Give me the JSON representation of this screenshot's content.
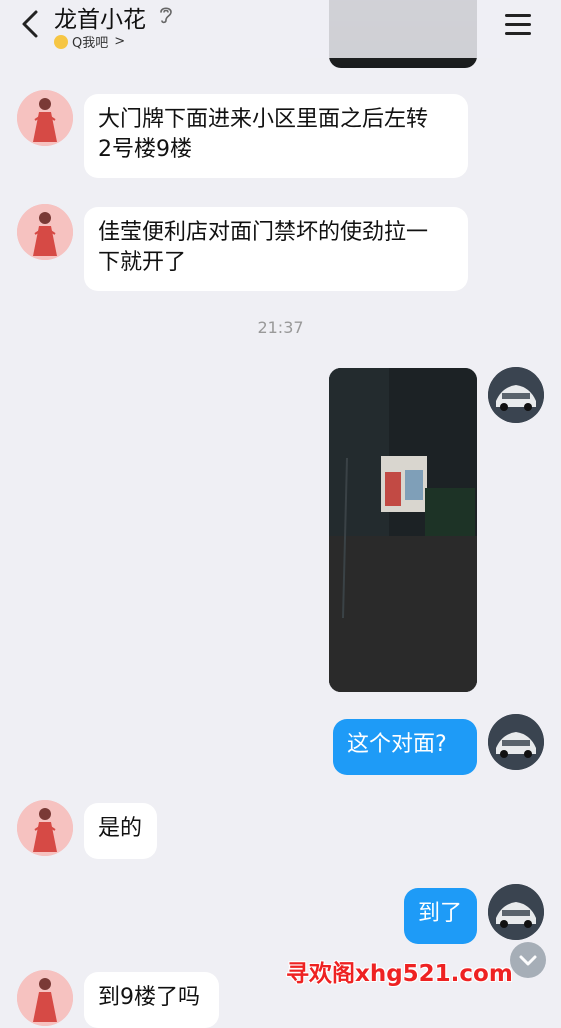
{
  "header": {
    "title": "龙首小花",
    "status_text": "Q我吧",
    "status_chevron": ">"
  },
  "messages": [
    {
      "from": "them",
      "text_line1": "大门牌下面进来小区里面之后左转",
      "text_line2": "2号楼9楼"
    },
    {
      "from": "them",
      "text_line1": "佳莹便利店对面门禁坏的使劲拉一",
      "text_line2": "下就开了"
    },
    {
      "timestamp": "21:37"
    },
    {
      "from": "me",
      "type": "image"
    },
    {
      "from": "me",
      "text": "这个对面?"
    },
    {
      "from": "them",
      "text": "是的"
    },
    {
      "from": "me",
      "text": "到了"
    },
    {
      "from": "them",
      "text": "到9楼了吗"
    }
  ],
  "watermark": "寻欢阁xhg521.com",
  "colors": {
    "background": "#efeff4",
    "incoming_bubble": "#ffffff",
    "outgoing_bubble": "#1e9bf7",
    "timestamp": "#999999",
    "watermark": "#ee2222"
  },
  "icons": [
    "back-icon",
    "ear-icon",
    "smile-icon",
    "menu-icon",
    "scroll-down-icon"
  ]
}
